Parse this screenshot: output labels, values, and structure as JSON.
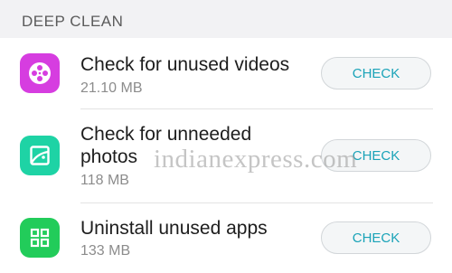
{
  "section": {
    "title": "DEEP CLEAN"
  },
  "items": [
    {
      "title": "Check for unused videos",
      "size": "21.10 MB",
      "button": "CHECK",
      "icon": "video-reel-icon",
      "icon_color": "#d63de0"
    },
    {
      "title_line1": "Check for unneeded",
      "title_line2": "photos",
      "size": "118 MB",
      "button": "CHECK",
      "icon": "photo-icon",
      "icon_color": "#1ed3a5"
    },
    {
      "title": "Uninstall unused apps",
      "size": "133 MB",
      "button": "CHECK",
      "icon": "apps-grid-icon",
      "icon_color": "#22cc5a"
    }
  ],
  "watermark": "indianexpress.com",
  "colors": {
    "accent": "#1aa3b8",
    "header_bg": "#f2f2f4"
  }
}
